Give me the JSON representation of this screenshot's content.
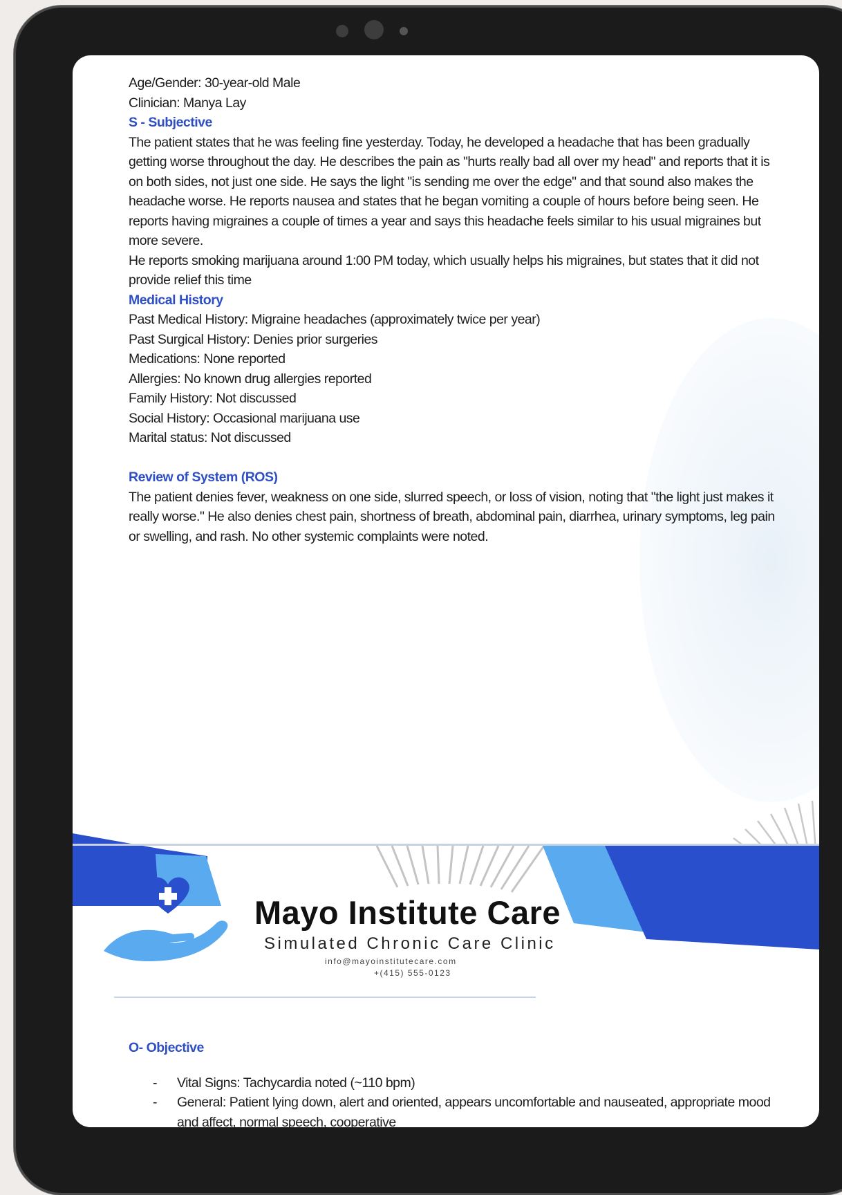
{
  "header_lines": {
    "age_gender": "Age/Gender: 30-year-old Male",
    "clinician": "Clinician: Manya Lay"
  },
  "subjective": {
    "heading": "S - Subjective",
    "paragraph1": "The patient states that he was feeling fine yesterday. Today, he developed a headache that has been gradually getting worse throughout the day. He describes the pain as \"hurts really bad all over my head\" and reports that it is on both sides, not just one side. He says the light \"is sending me over the edge\" and that sound also makes the headache worse. He reports nausea and states that he began vomiting a couple of hours before being seen. He reports having migraines a couple of times a year and says this headache feels similar to his usual migraines but more severe.",
    "paragraph2": "He reports smoking marijuana around 1:00 PM today, which usually helps his migraines, but states that it did not provide relief this time"
  },
  "medical_history": {
    "heading": "Medical History",
    "items": [
      "Past Medical History: Migraine headaches (approximately twice per year)",
      "Past Surgical History: Denies prior surgeries",
      "Medications: None reported",
      "Allergies: No known drug allergies reported",
      "Family History: Not discussed",
      "Social History: Occasional marijuana use",
      "Marital status: Not discussed"
    ]
  },
  "ros": {
    "heading": "Review of System (ROS)",
    "paragraph": "The patient denies fever, weakness on one side, slurred speech, or loss of vision, noting that \"the light just makes it really worse.\" He also denies chest pain, shortness of breath, abdominal pain, diarrhea, urinary symptoms, leg pain or swelling, and rash. No other systemic complaints were noted."
  },
  "brand": {
    "title": "Mayo Institute Care",
    "subtitle": "Simulated Chronic Care Clinic",
    "email": "info@mayoinstitutecare.com",
    "phone": "+(415) 555-0123",
    "colors": {
      "primary": "#2a4fcc",
      "light": "#5aaaf0",
      "heading": "#2f4fc4"
    }
  },
  "objective": {
    "heading": "O- Objective",
    "items": [
      "Vital Signs: Tachycardia noted (~110 bpm)",
      "General: Patient lying down, alert and oriented, appears uncomfortable and nauseated, appropriate mood and affect, normal speech, cooperative"
    ]
  }
}
